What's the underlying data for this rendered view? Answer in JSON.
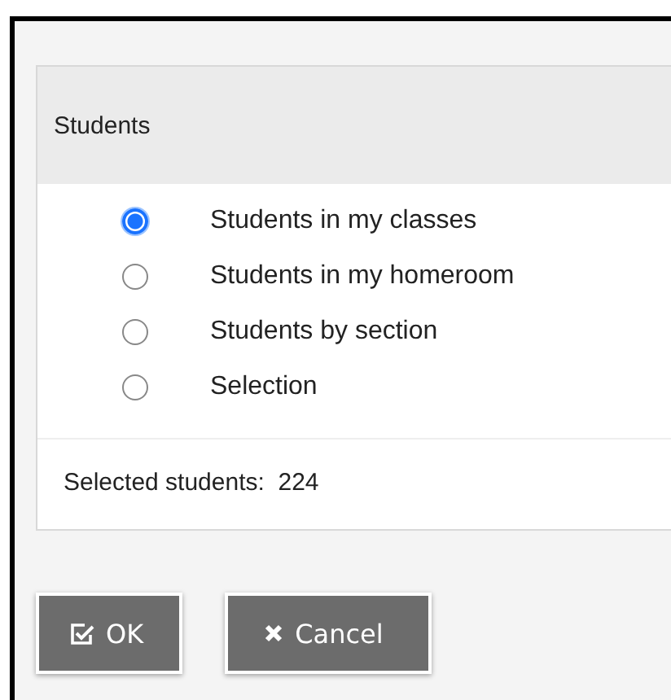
{
  "panel": {
    "title": "Students",
    "options": [
      {
        "label": "Students in my classes",
        "selected": true
      },
      {
        "label": "Students in my homeroom",
        "selected": false
      },
      {
        "label": "Students by section",
        "selected": false
      },
      {
        "label": "Selection",
        "selected": false
      }
    ],
    "summary": "Selected students:  224"
  },
  "buttons": [
    {
      "kind": "ok",
      "label": "OK"
    },
    {
      "kind": "cancel",
      "label": "Cancel"
    }
  ]
}
